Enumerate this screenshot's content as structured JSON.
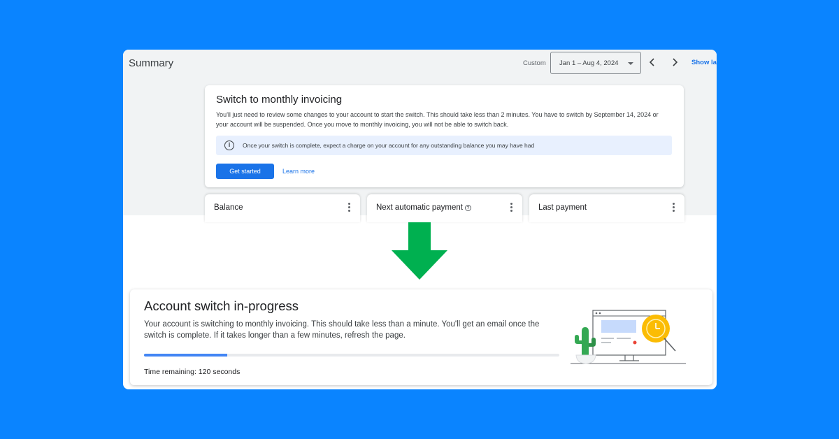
{
  "header": {
    "title": "Summary",
    "custom_label": "Custom",
    "date_range": "Jan 1 – Aug 4, 2024",
    "show_link": "Show last"
  },
  "invoice_card": {
    "title": "Switch to monthly invoicing",
    "description": "You'll just need to review some changes to your account to start the switch. This should take less than 2 minutes. You have to switch by September 14, 2024 or your account will be suspended. Once you move to monthly invoicing, you will not be able to switch back.",
    "info_text": "Once your switch is complete, expect a charge on your account for any outstanding balance you may have had",
    "primary_button": "Get started",
    "secondary_link": "Learn more"
  },
  "mini_cards": [
    {
      "label": "Balance"
    },
    {
      "label": "Next automatic payment"
    },
    {
      "label": "Last payment"
    }
  ],
  "progress_card": {
    "title": "Account switch in-progress",
    "description": "Your account is switching to monthly invoicing. This should take less than a minute. You'll get an email once the switch is complete. If it takes longer than a few minutes, refresh the page.",
    "progress_percent": 20,
    "time_remaining": "Time remaining: 120 seconds"
  },
  "colors": {
    "background": "#0a84ff",
    "primary": "#1a73e8",
    "arrow": "#00b050",
    "progress": "#4285f4"
  },
  "icons": {
    "info": "info-icon",
    "help": "help-circle-icon",
    "menu": "more-vert-icon",
    "prev": "chevron-left-icon",
    "next": "chevron-right-icon",
    "dropdown": "caret-down-icon",
    "arrow": "arrow-down-icon"
  }
}
